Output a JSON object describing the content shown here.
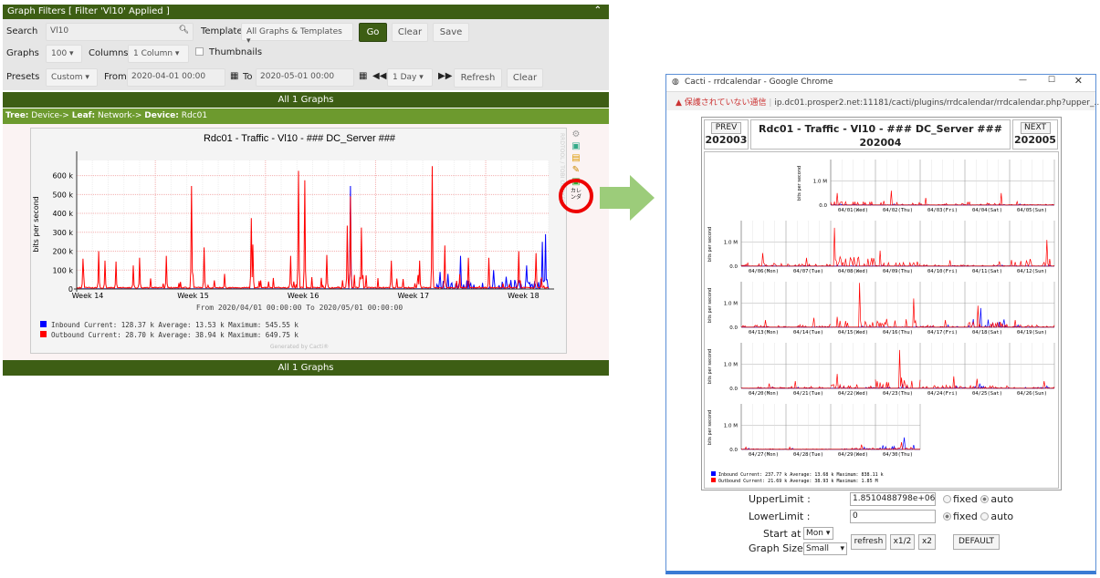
{
  "filters": {
    "header": "Graph Filters [ Filter 'Vl10' Applied ]",
    "search_label": "Search",
    "search_value": "Vl10",
    "template_label": "Template",
    "template_value": "All Graphs & Templates",
    "go": "Go",
    "clear": "Clear",
    "save": "Save",
    "graphs_label": "Graphs",
    "graphs_value": "100",
    "columns_label": "Columns",
    "columns_value": "1 Column",
    "thumbnails": "Thumbnails",
    "presets_label": "Presets",
    "presets_value": "Custom",
    "from_label": "From",
    "from_value": "2020-04-01 00:00",
    "to_label": "To",
    "to_value": "2020-05-01 00:00",
    "span_value": "1 Day",
    "refresh": "Refresh",
    "clear2": "Clear"
  },
  "banner": "All 1 Graphs",
  "tree": {
    "tree_label": "Tree:",
    "tree_value": "Device->",
    "leaf_label": "Leaf:",
    "leaf_value": "Network->",
    "device_label": "Device:",
    "device_value": "Rdc01"
  },
  "graph": {
    "title": "Rdc01 - Traffic - Vl10 - ### DC_Server ###",
    "ylabel": "bits per second",
    "range": "From 2020/04/01 00:00:00 To 2020/05/01 00:00:00",
    "watermark": "RRDTOOL / TOBI OETIKER",
    "generated": "Generated by Cacti®",
    "legend": [
      {
        "name": "Inbound",
        "color": "#0000ff",
        "current": "128.37 k",
        "average": "13.53 k",
        "maximum": "545.55 k"
      },
      {
        "name": "Outbound",
        "color": "#ff0000",
        "current": "28.70 k",
        "average": "38.94 k",
        "maximum": "649.75 k"
      }
    ],
    "labels": {
      "current": "Current:",
      "average": "Average:",
      "maximum": "Maximum:"
    }
  },
  "chart_data": {
    "type": "line",
    "xlabel": "",
    "ylabel": "bits per second",
    "x_range_days": [
      0,
      30
    ],
    "ylim": [
      0,
      680
    ],
    "y_unit": "k",
    "yticks": [
      "0",
      "100 k",
      "200 k",
      "300 k",
      "400 k",
      "500 k",
      "600 k"
    ],
    "xticks": [
      {
        "label": "Week 14",
        "day": 0.7
      },
      {
        "label": "Week 15",
        "day": 7.4
      },
      {
        "label": "Week 16",
        "day": 14.4
      },
      {
        "label": "Week 17",
        "day": 21.4
      },
      {
        "label": "Week 18",
        "day": 28.4
      }
    ],
    "series": [
      {
        "name": "Outbound",
        "color": "#ff0000",
        "spikes": [
          [
            0.4,
            160
          ],
          [
            1.4,
            200
          ],
          [
            1.8,
            150
          ],
          [
            2.5,
            145
          ],
          [
            3.6,
            125
          ],
          [
            4.0,
            165
          ],
          [
            5.7,
            175
          ],
          [
            7.3,
            545
          ],
          [
            8.1,
            220
          ],
          [
            9.4,
            80
          ],
          [
            11.1,
            375
          ],
          [
            11.2,
            235
          ],
          [
            13.6,
            175
          ],
          [
            14.1,
            625
          ],
          [
            14.5,
            575
          ],
          [
            15.9,
            180
          ],
          [
            17.2,
            335
          ],
          [
            17.4,
            490
          ],
          [
            18.1,
            325
          ],
          [
            20.0,
            150
          ],
          [
            21.8,
            150
          ],
          [
            22.6,
            650
          ],
          [
            23.4,
            230
          ],
          [
            24.9,
            165
          ],
          [
            26.2,
            165
          ],
          [
            28.1,
            200
          ],
          [
            29.2,
            190
          ]
        ]
      },
      {
        "name": "Inbound",
        "color": "#0000ff",
        "spikes": [
          [
            17.4,
            545
          ],
          [
            23.1,
            90
          ],
          [
            23.6,
            80
          ],
          [
            24.4,
            175
          ],
          [
            26.5,
            100
          ],
          [
            27.3,
            65
          ],
          [
            28.6,
            125
          ],
          [
            29.6,
            250
          ],
          [
            29.8,
            290
          ]
        ]
      }
    ]
  },
  "popup": {
    "window_title": "Cacti - rrdcalendar - Google Chrome",
    "insecure": "保護されていない通信",
    "url": "ip.dc01.prosper2.net:11181/cacti/plugins/rrdcalendar/rrdcalendar.php?upper_...",
    "prev": "PREV",
    "prev_month": "202003",
    "next": "NEXT",
    "next_month": "202005",
    "title": "Rdc01 - Traffic - Vl10 - ### DC_Server ###",
    "month": "202004",
    "ylabel": "bits per second",
    "yticks": [
      "0.0",
      "1.0 M"
    ],
    "days": [
      {
        "label": "04/01(Wed)",
        "out": 0.5,
        "in": 0.05
      },
      {
        "label": "04/02(Thu)",
        "out": 0.6,
        "in": 0.05
      },
      {
        "label": "04/03(Fri)",
        "out": 0.3,
        "in": 0.02
      },
      {
        "label": "04/04(Sat)",
        "out": 0.5,
        "in": 0.03
      },
      {
        "label": "04/05(Sun)",
        "out": 0.15,
        "in": 0.05
      },
      {
        "label": "04/06(Mon)",
        "out": 0.55,
        "in": 0.04
      },
      {
        "label": "04/07(Tue)",
        "out": 0.35,
        "in": 0.03
      },
      {
        "label": "04/08(Wed)",
        "out": 1.6,
        "in": 0.05
      },
      {
        "label": "04/09(Thu)",
        "out": 0.65,
        "in": 0.04
      },
      {
        "label": "04/10(Fri)",
        "out": 0.25,
        "in": 0.03
      },
      {
        "label": "04/11(Sat)",
        "out": 0.2,
        "in": 0.05
      },
      {
        "label": "04/12(Sun)",
        "out": 1.1,
        "in": 0.04
      },
      {
        "label": "04/13(Mon)",
        "out": 0.3,
        "in": 0.03
      },
      {
        "label": "04/14(Tue)",
        "out": 0.4,
        "in": 0.03
      },
      {
        "label": "04/15(Wed)",
        "out": 1.85,
        "in": 0.05
      },
      {
        "label": "04/16(Thu)",
        "out": 1.2,
        "in": 0.05
      },
      {
        "label": "04/17(Fri)",
        "out": 0.3,
        "in": 0.1
      },
      {
        "label": "04/18(Sat)",
        "out": 0.9,
        "in": 0.8
      },
      {
        "label": "04/19(Sun)",
        "out": 0.3,
        "in": 0.1
      },
      {
        "label": "04/20(Mon)",
        "out": 0.2,
        "in": 0.05
      },
      {
        "label": "04/21(Tue)",
        "out": 0.3,
        "in": 0.05
      },
      {
        "label": "04/22(Wed)",
        "out": 0.6,
        "in": 0.1
      },
      {
        "label": "04/23(Thu)",
        "out": 1.6,
        "in": 0.15
      },
      {
        "label": "04/24(Fri)",
        "out": 0.5,
        "in": 0.1
      },
      {
        "label": "04/25(Sat)",
        "out": 0.4,
        "in": 0.2
      },
      {
        "label": "04/26(Sun)",
        "out": 0.3,
        "in": 0.1
      },
      {
        "label": "04/27(Mon)",
        "out": 0.1,
        "in": 0.05
      },
      {
        "label": "04/28(Tue)",
        "out": 0.1,
        "in": 0.05
      },
      {
        "label": "04/29(Wed)",
        "out": 0.2,
        "in": 0.1
      },
      {
        "label": "04/30(Thu)",
        "out": 0.3,
        "in": 0.5
      }
    ],
    "legend": [
      {
        "name": "Inbound",
        "color": "#0000ff",
        "current": "237.77 k",
        "average": "13.68 k",
        "maximum": "838.11 k"
      },
      {
        "name": "Outbound",
        "color": "#ff0000",
        "current": "21.69 k",
        "average": "38.93 k",
        "maximum": "1.85 M"
      }
    ],
    "upper_label": "UpperLimit :",
    "upper_value": "1.8510488798e+06",
    "lower_label": "LowerLimit :",
    "lower_value": "0",
    "fixed": "fixed",
    "auto": "auto",
    "upper_mode": "auto",
    "lower_mode": "fixed",
    "start_label": "Start at",
    "start_value": "Mon",
    "size_label": "Graph Size",
    "size_value": "Small",
    "refresh": "refresh",
    "half": "x1/2",
    "double": "x2",
    "default": "DEFAULT"
  }
}
